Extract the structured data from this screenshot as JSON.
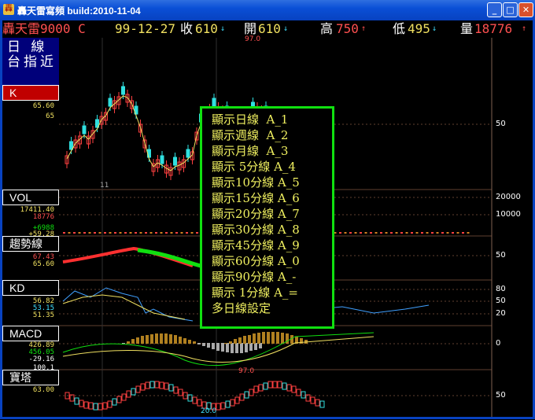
{
  "window": {
    "title": "轟天雷寫頻 build:2010-11-04"
  },
  "quote": {
    "name": "轟天雷9000 C",
    "date": "99-12-27",
    "close_label": "收",
    "close": "610",
    "open_label": "開",
    "open": "610",
    "high_label": "高",
    "high": "750",
    "low_label": "低",
    "low": "495",
    "volume_label": "量",
    "volume": "18776"
  },
  "mode": {
    "line1": "日 線",
    "line2": "台指近"
  },
  "panels": {
    "k": {
      "label": "K",
      "v1": "65.60",
      "v2": "65"
    },
    "vol": {
      "label": "VOL",
      "v1": "17411.40",
      "v2": "18776",
      "v3": "+6988",
      "v4": "+59.28"
    },
    "trend": {
      "label": "趨勢線",
      "v1": "67.43",
      "v2": "65.60"
    },
    "kd": {
      "label": "KD",
      "v1": "56.82",
      "v2": "53.15",
      "v3": "51.35"
    },
    "macd": {
      "label": "MACD",
      "v1": "426.89",
      "v2": "456.05",
      "v3": "-29.16",
      "v4": "100.1"
    },
    "tower": {
      "label": "寶塔",
      "v1": "63.00"
    }
  },
  "axis": {
    "k50": "50",
    "vol20000": "20000",
    "vol10000": "10000",
    "trend50": "50",
    "kd80": "80",
    "kd50": "50",
    "kd20": "20",
    "macd0": "0",
    "tower50": "50"
  },
  "annotations": {
    "khigh": "97.0",
    "klow": "11",
    "towerhigh": "97.0",
    "towerlow": "20.0"
  },
  "menu": {
    "items": [
      "顯示日線  A_1",
      "顯示週線  A_2",
      "顯示月線  A_3",
      "顯示 5分線 A_4",
      "顯示10分線 A_5",
      "顯示15分線 A_6",
      "顯示20分線 A_7",
      "顯示30分線 A_8",
      "顯示45分線 A_9",
      "顯示60分線 A_0",
      "顯示90分線 A_-",
      "顯示 1分線 A_=",
      "多日線設定"
    ]
  }
}
